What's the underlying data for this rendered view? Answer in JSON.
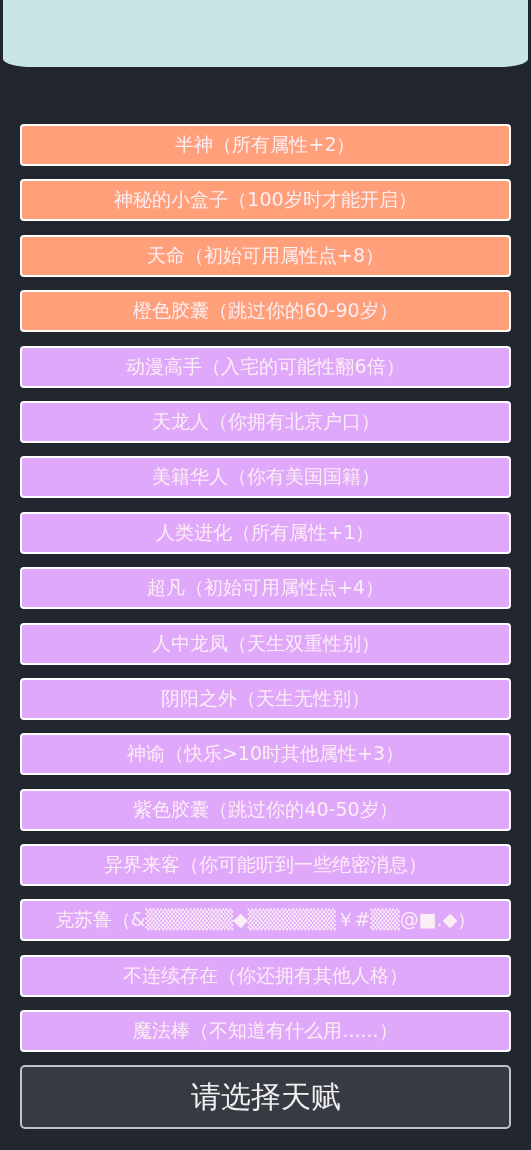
{
  "talents": [
    {
      "label": "半神（所有属性+2）",
      "color": "#ffa07a"
    },
    {
      "label": "神秘的小盒子（100岁时才能开启）",
      "color": "#ffa07a"
    },
    {
      "label": "天命（初始可用属性点+8）",
      "color": "#ffa07a"
    },
    {
      "label": "橙色胶囊（跳过你的60-90岁）",
      "color": "#ffa07a"
    },
    {
      "label": "动漫高手（入宅的可能性翻6倍）",
      "color": "#e0a8fa"
    },
    {
      "label": "天龙人（你拥有北京户口）",
      "color": "#e0a8fa"
    },
    {
      "label": "美籍华人（你有美国国籍）",
      "color": "#e0a8fa"
    },
    {
      "label": "人类进化（所有属性+1）",
      "color": "#e0a8fa"
    },
    {
      "label": "超凡（初始可用属性点+4）",
      "color": "#e0a8fa"
    },
    {
      "label": "人中龙凤（天生双重性别）",
      "color": "#e0a8fa"
    },
    {
      "label": "阴阳之外（天生无性别）",
      "color": "#e0a8fa"
    },
    {
      "label": "神谕（快乐>10时其他属性+3）",
      "color": "#e0a8fa"
    },
    {
      "label": "紫色胶囊（跳过你的40-50岁）",
      "color": "#e0a8fa"
    },
    {
      "label": "异界来客（你可能听到一些绝密消息）",
      "color": "#e0a8fa"
    },
    {
      "label": "克苏鲁（&▒▒▒▒▒▒◆▒▒▒▒▒▒￥#▒▒@■.◆）",
      "color": "#e0a8fa"
    },
    {
      "label": "不连续存在（你还拥有其他人格）",
      "color": "#e0a8fa"
    },
    {
      "label": "魔法棒（不知道有什么用......）",
      "color": "#e0a8fa"
    }
  ],
  "confirm_button": "请选择天赋"
}
